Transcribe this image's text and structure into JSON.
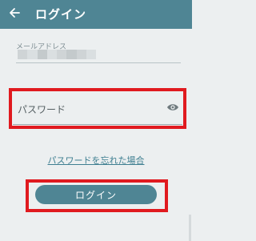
{
  "appbar": {
    "title": "ログイン",
    "back_icon": "arrow-left-icon",
    "background": "#4f8594"
  },
  "form": {
    "email": {
      "label": "メールアドレス",
      "value_masked": true
    },
    "password": {
      "placeholder": "パスワード",
      "visibility_icon": "eye-icon"
    },
    "forgot_link": "パスワードを忘れた場合",
    "submit_label": "ログイン"
  },
  "colors": {
    "accent": "#4f8594",
    "highlight": "#e01a1f",
    "link": "#3f7f91"
  }
}
